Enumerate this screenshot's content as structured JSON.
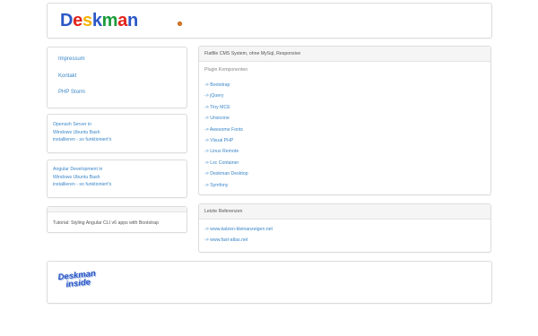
{
  "header": {
    "logo_text": "Deskman",
    "logo_letters": [
      "D",
      "e",
      "s",
      "k",
      "m",
      "a",
      "n"
    ]
  },
  "nav": {
    "items": [
      {
        "label": "Impressum"
      },
      {
        "label": "Kontakt"
      },
      {
        "label": "PHP Storm"
      }
    ]
  },
  "sidebar_posts": [
    {
      "lines": [
        "Openssh Server in",
        "Windows Ubuntu Bash",
        "installieren - so funktioniert's"
      ]
    },
    {
      "lines": [
        "Angular Development in",
        "Windows Ubuntu Bash",
        "installieren - so funktioniert's"
      ]
    },
    {
      "text": "Tutorial: Styling Angular CLI v6 apps with Bootstrap"
    }
  ],
  "cms": {
    "title": "Flatfile CMS System, ohne MySql, Responsive",
    "subtitle": "Plugin Komponenten",
    "items": [
      "-> Bootstrap",
      "-> jQuery",
      "-> Tiny MCE",
      "-> Unsicone",
      "-> Awesome Fonts",
      "-> Visual PHP",
      "-> Linux Remote",
      "-> Lxc Container",
      "-> Deskman Desktop",
      "-> Symfony"
    ]
  },
  "references": {
    "title": "Letzte Referenzen",
    "items": [
      "-> www.katzen-kleinanzeigen.net",
      "-> www.fast-atlas.net"
    ]
  },
  "footer": {
    "badge_line1": "Deskman",
    "badge_line2": "inside"
  },
  "colors": {
    "link": "#3a86c8",
    "logo_blue": "#2b57c6",
    "logo_red": "#e2231a",
    "logo_yellow": "#f2b200",
    "logo_green": "#1a9c3a"
  }
}
